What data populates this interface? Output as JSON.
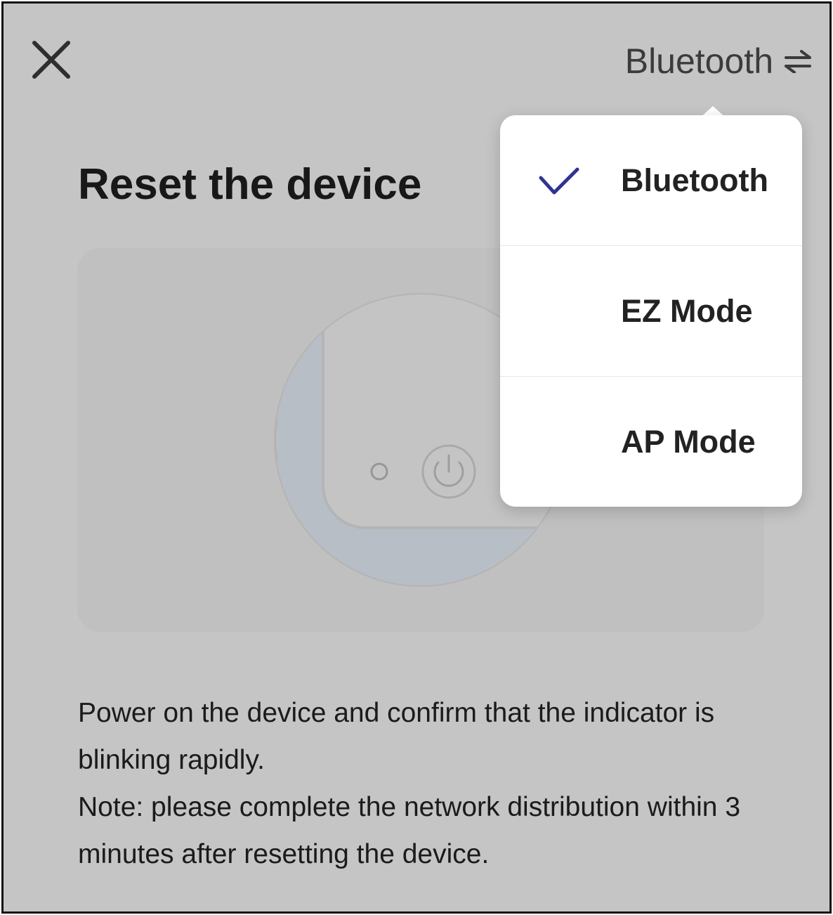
{
  "header": {
    "close_icon": "close-icon",
    "mode_label": "Bluetooth",
    "mode_switch_icon": "swap-arrows-icon"
  },
  "main": {
    "title": "Reset the device",
    "illustration_icons": [
      "device-indicator-light-icon",
      "power-button-icon"
    ],
    "description": {
      "line1": "Power on the device and confirm that the indicator is blinking rapidly.",
      "line2": "Note: please complete the network distribution within 3 minutes after resetting the device."
    }
  },
  "mode_menu": {
    "selected_index": 0,
    "items": [
      {
        "label": "Bluetooth",
        "selected": true
      },
      {
        "label": "EZ Mode",
        "selected": false
      },
      {
        "label": "AP Mode",
        "selected": false
      }
    ]
  },
  "colors": {
    "check": "#2f3491",
    "overlay": "rgba(0,0,0,0.2)"
  }
}
